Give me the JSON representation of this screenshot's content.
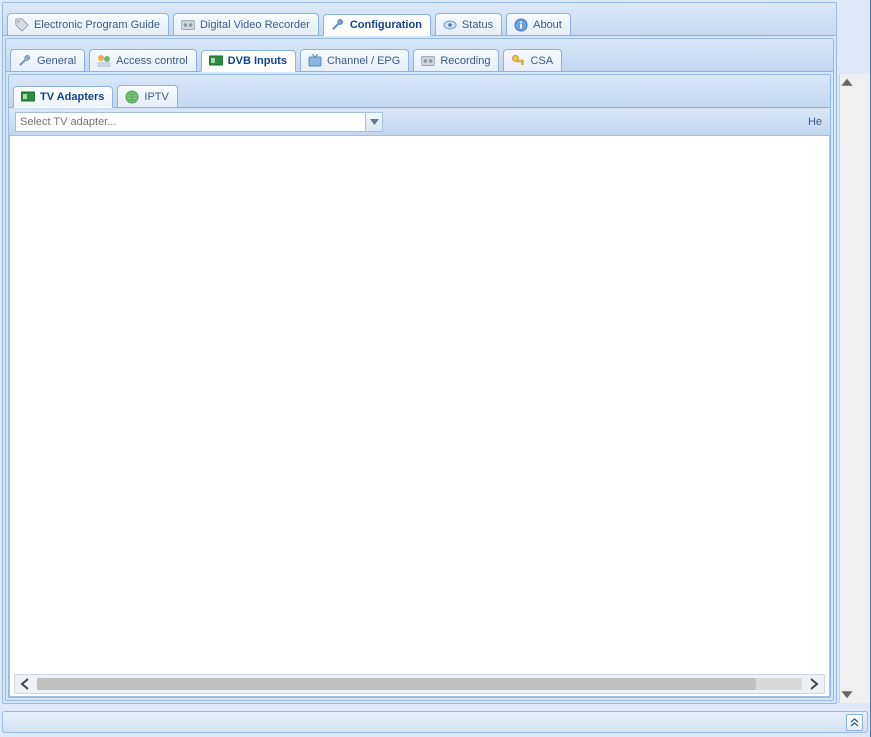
{
  "top_tabs": [
    {
      "id": "epg",
      "label": "Electronic Program Guide",
      "icon": "tag-icon",
      "active": false
    },
    {
      "id": "dvr",
      "label": "Digital Video Recorder",
      "icon": "recorder-icon",
      "active": false
    },
    {
      "id": "config",
      "label": "Configuration",
      "icon": "wrench-icon",
      "active": true
    },
    {
      "id": "status",
      "label": "Status",
      "icon": "eye-icon",
      "active": false
    },
    {
      "id": "about",
      "label": "About",
      "icon": "info-icon",
      "active": false
    }
  ],
  "config_tabs": [
    {
      "id": "general",
      "label": "General",
      "icon": "wrench-icon",
      "active": false
    },
    {
      "id": "access",
      "label": "Access control",
      "icon": "users-icon",
      "active": false
    },
    {
      "id": "dvb",
      "label": "DVB Inputs",
      "icon": "card-green-icon",
      "active": true
    },
    {
      "id": "channel",
      "label": "Channel / EPG",
      "icon": "tv-icon",
      "active": false
    },
    {
      "id": "record",
      "label": "Recording",
      "icon": "recorder-icon",
      "active": false
    },
    {
      "id": "csa",
      "label": "CSA",
      "icon": "key-icon",
      "active": false
    }
  ],
  "dvb_tabs": [
    {
      "id": "tvadapters",
      "label": "TV Adapters",
      "icon": "card-green-icon",
      "active": true
    },
    {
      "id": "iptv",
      "label": "IPTV",
      "icon": "globe-icon",
      "active": false
    }
  ],
  "adapter_selector": {
    "placeholder": "Select TV adapter...",
    "value": "",
    "help_label": "He"
  },
  "south_panel": {
    "expand_glyph": "«"
  }
}
